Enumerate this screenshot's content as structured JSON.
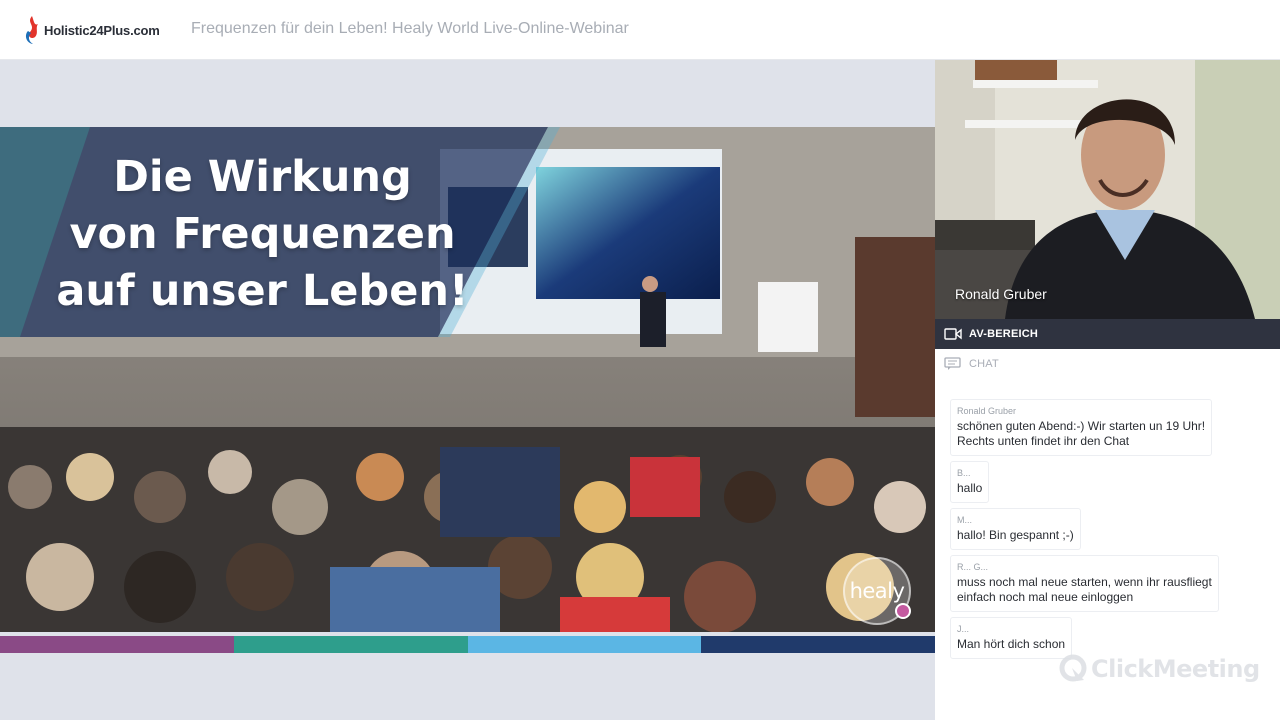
{
  "header": {
    "logo_text": "Holistic24Plus.com",
    "webinar_title": "Frequenzen für dein Leben! Healy World Live-Online-Webinar"
  },
  "slide": {
    "headline_line1": "Die Wirkung",
    "headline_line2": "von Frequenzen",
    "headline_line3": "auf unser Leben!",
    "brand_logo": "healy",
    "color_bar": [
      "#8a4a86",
      "#2e9e8c",
      "#5bb6e4",
      "#203a6b"
    ]
  },
  "presenter": {
    "name": "Ronald Gruber"
  },
  "tabs": {
    "av": "AV-BEREICH",
    "chat": "CHAT"
  },
  "chat": {
    "messages": [
      {
        "author": "Ronald Gruber",
        "line1": "schönen guten Abend:-) Wir starten un 19 Uhr!",
        "line2": "Rechts unten findet ihr den Chat"
      },
      {
        "author": "B...",
        "line1": "hallo",
        "line2": ""
      },
      {
        "author": "M...",
        "line1": "hallo! Bin gespannt ;-)",
        "line2": ""
      },
      {
        "author": "R... G...",
        "line1": "muss noch mal neue starten, wenn ihr rausfliegt",
        "line2": "einfach noch mal neue einloggen"
      },
      {
        "author": "J...",
        "line1": "Man hört dich schon",
        "line2": ""
      }
    ]
  },
  "footer": {
    "brand": "ClickMeeting"
  },
  "colors": {
    "av_tab_bg": "#2f3340",
    "stage_bg": "#dfe2ea"
  }
}
